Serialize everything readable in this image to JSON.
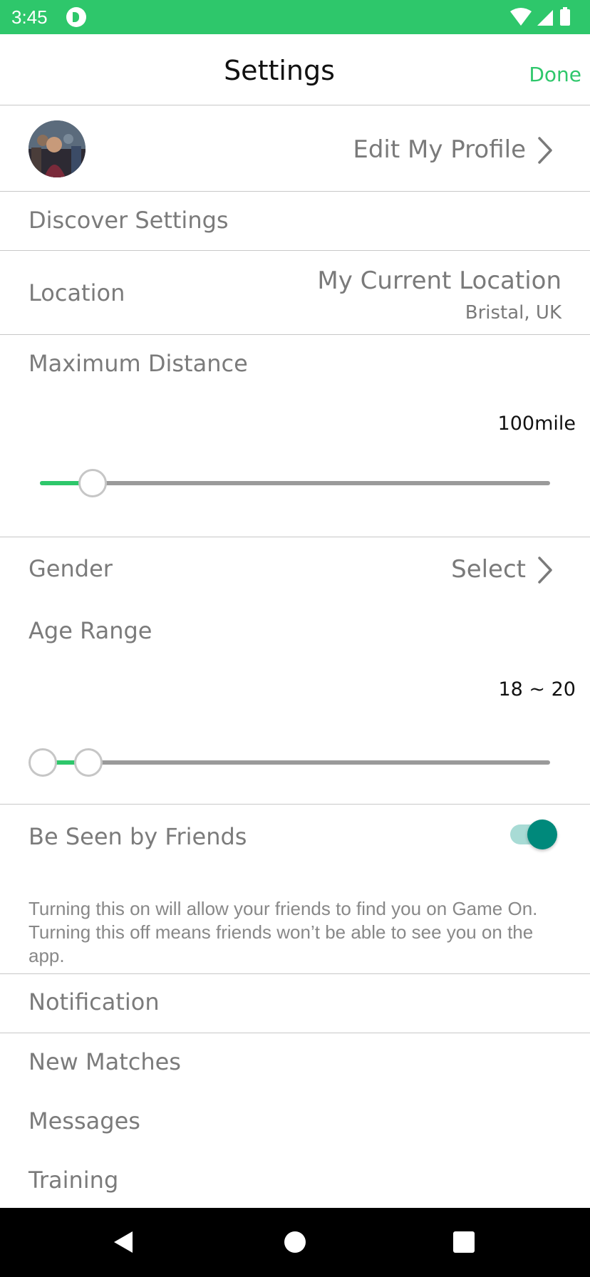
{
  "status_bar": {
    "time": "3:45",
    "icons": [
      "app-notification-icon",
      "wifi-icon",
      "signal-icon",
      "battery-icon"
    ],
    "color": "#2ec76b"
  },
  "header": {
    "title": "Settings",
    "done_label": "Done"
  },
  "profile": {
    "edit_label": "Edit My Profile"
  },
  "discover": {
    "section_label": "Discover Settings"
  },
  "location": {
    "label": "Location",
    "value": "My Current Location",
    "sub_value": "Bristal, UK"
  },
  "distance": {
    "label": "Maximum Distance",
    "value_text": "100mile",
    "slider_fraction": 0.1
  },
  "gender": {
    "label": "Gender",
    "value": "Select"
  },
  "age": {
    "label": "Age Range",
    "value_text": "18 ~ 20",
    "range_low_fraction": 0.0,
    "range_high_fraction": 0.09
  },
  "friends": {
    "label": "Be Seen by Friends",
    "toggle_on": true,
    "description": "Turning this on will allow your friends to find you on Game On. Turning this off means friends won’t be able to see you on the app."
  },
  "notification": {
    "section_label": "Notification",
    "items": [
      {
        "label": "New Matches"
      },
      {
        "label": "Messages"
      },
      {
        "label": "Training"
      }
    ]
  },
  "nav": {
    "icons": [
      "back-icon",
      "home-icon",
      "recents-icon"
    ]
  },
  "colors": {
    "accent": "#2ec76b",
    "toggle": "#00897b",
    "divider": "#c8c8c8"
  }
}
